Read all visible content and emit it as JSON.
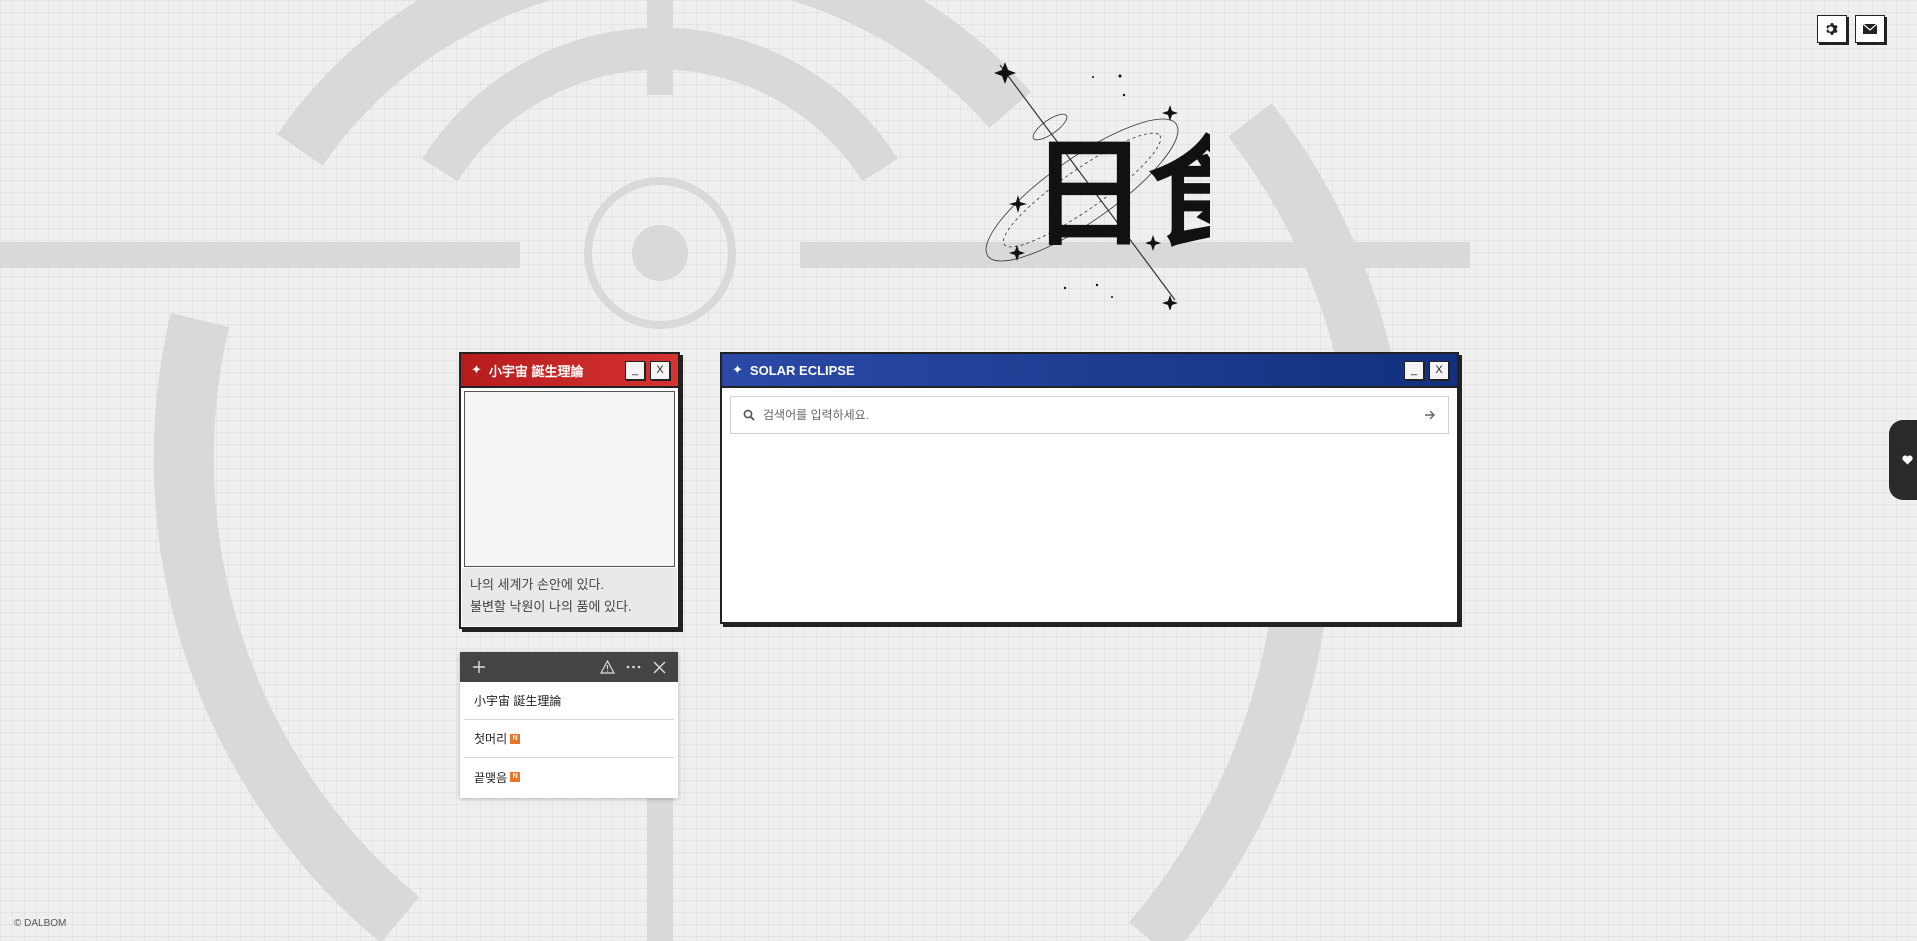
{
  "top_actions": {
    "settings_icon": "gear-icon",
    "mail_icon": "envelope-icon"
  },
  "side_tab": {
    "icon": "heart-icon"
  },
  "logo": {
    "text": "日食"
  },
  "red_window": {
    "title": "小宇宙 誕生理論",
    "minimize_label": "_",
    "close_label": "X",
    "line1": "나의 세계가 손안에 있다.",
    "line2": "불변할 낙원이 나의 품에 있다.",
    "accent": "#c82626"
  },
  "blue_window": {
    "title": "SOLAR ECLIPSE",
    "minimize_label": "_",
    "close_label": "X",
    "search_placeholder": "검색어를 입력하세요.",
    "accent": "#1d3a8f"
  },
  "menu": {
    "items": [
      {
        "label": "小宇宙 誕生理論",
        "badge": ""
      },
      {
        "label": "첫머리",
        "badge": "N"
      },
      {
        "label": "끝맺음",
        "badge": "N"
      }
    ]
  },
  "footer": {
    "text": "© DALBOM"
  }
}
